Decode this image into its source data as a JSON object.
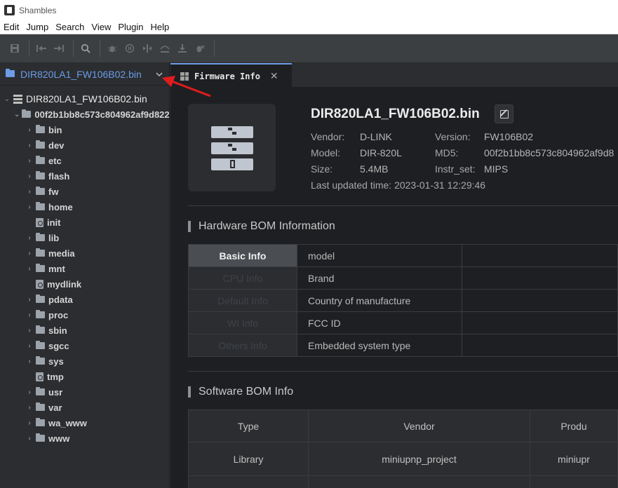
{
  "window": {
    "title": "Shambles"
  },
  "menu": [
    "Edit",
    "Jump",
    "Search",
    "View",
    "Plugin",
    "Help"
  ],
  "sidebar": {
    "header_title": "DIR820LA1_FW106B02.bin",
    "root": "DIR820LA1_FW106B02.bin",
    "subfolder": "00f2b1bb8c573c804962af9d822",
    "items": [
      {
        "name": "bin",
        "kind": "folder"
      },
      {
        "name": "dev",
        "kind": "folder"
      },
      {
        "name": "etc",
        "kind": "folder"
      },
      {
        "name": "flash",
        "kind": "folder"
      },
      {
        "name": "fw",
        "kind": "folder"
      },
      {
        "name": "home",
        "kind": "folder"
      },
      {
        "name": "init",
        "kind": "file"
      },
      {
        "name": "lib",
        "kind": "folder"
      },
      {
        "name": "media",
        "kind": "folder"
      },
      {
        "name": "mnt",
        "kind": "folder"
      },
      {
        "name": "mydlink",
        "kind": "file"
      },
      {
        "name": "pdata",
        "kind": "folder"
      },
      {
        "name": "proc",
        "kind": "folder"
      },
      {
        "name": "sbin",
        "kind": "folder"
      },
      {
        "name": "sgcc",
        "kind": "folder"
      },
      {
        "name": "sys",
        "kind": "folder"
      },
      {
        "name": "tmp",
        "kind": "file"
      },
      {
        "name": "usr",
        "kind": "folder"
      },
      {
        "name": "var",
        "kind": "folder"
      },
      {
        "name": "wa_www",
        "kind": "folder"
      },
      {
        "name": "www",
        "kind": "folder"
      }
    ]
  },
  "tab": {
    "label": "Firmware Info"
  },
  "firmware": {
    "name": "DIR820LA1_FW106B02.bin",
    "vendor_label": "Vendor:",
    "vendor": "D-LINK",
    "model_label": "Model:",
    "model": "DIR-820L",
    "size_label": "Size:",
    "size": "5.4MB",
    "version_label": "Version:",
    "version": "FW106B02",
    "md5_label": "MD5:",
    "md5": "00f2b1bb8c573c804962af9d8",
    "instr_label": "Instr_set:",
    "instr": "MIPS",
    "updated": "Last updated time: 2023-01-31 12:29:46"
  },
  "hardware": {
    "title": "Hardware BOM Information",
    "rows": [
      {
        "side": "Basic Info",
        "label": "model"
      },
      {
        "side": "CPU Info",
        "label": "Brand"
      },
      {
        "side": "Default Info",
        "label": "Country of manufacture"
      },
      {
        "side": "WI Info",
        "label": "FCC ID"
      },
      {
        "side": "Others Info",
        "label": "Embedded system type"
      }
    ]
  },
  "software": {
    "title": "Software BOM Info",
    "headers": [
      "Type",
      "Vendor",
      "Produ"
    ],
    "rows": [
      [
        "Library",
        "miniupnp_project",
        "miniupr"
      ]
    ]
  },
  "colors": {
    "accent": "#6c9ce8",
    "annotation": "#e01c1c"
  }
}
